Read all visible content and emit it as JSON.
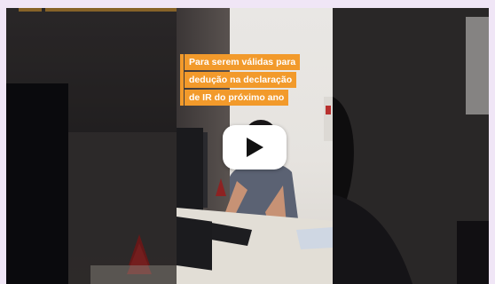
{
  "overlay": {
    "lines": [
      "Para serem válidas para",
      "dedução na declaração",
      "de IR do próximo ano"
    ]
  },
  "player": {
    "play_icon": "play-icon"
  },
  "colors": {
    "caption_bg": "#f29a2b",
    "page_bg": "#f0e6f6"
  }
}
